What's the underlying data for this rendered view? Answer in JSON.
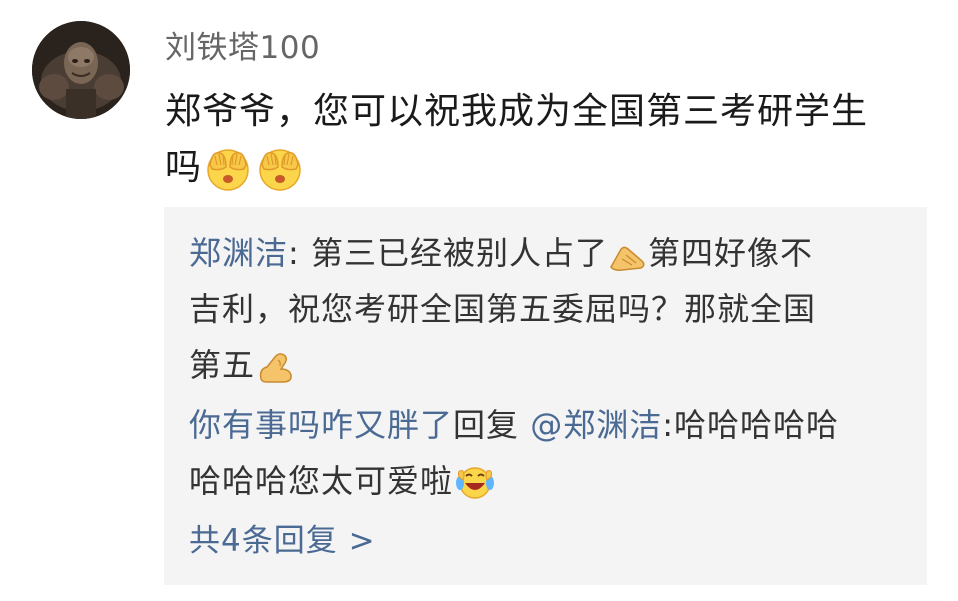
{
  "comment": {
    "username": "刘铁塔100",
    "text_line1": "郑爷爷，您可以祝我成为全国第三考研学生",
    "text_line2": "吗",
    "emojis": [
      "covering-face-emoji",
      "covering-face-emoji"
    ]
  },
  "replies": [
    {
      "author": "郑渊洁",
      "separator": ": ",
      "line1_a": "第三已经被别人占了",
      "line1_emoji": "pointing-hand-emoji",
      "line1_b": "第四好像不",
      "line2": "吉利，祝您考研全国第五委屈吗？那就全国",
      "line3": "第五",
      "line3_emoji": "flexed-biceps-emoji"
    },
    {
      "author": "你有事吗咋又胖了",
      "reply_word": "回复 ",
      "mention": "@郑渊洁",
      "colon": ":",
      "line1_text": "哈哈哈哈哈",
      "line2_text": "哈哈哈您太可爱啦",
      "line2_emoji": "laughing-tears-emoji"
    }
  ],
  "more_replies": "共4条回复 >",
  "colors": {
    "link_blue": "#4a6a94",
    "reply_bg": "#f4f4f4",
    "username_gray": "#666666"
  }
}
